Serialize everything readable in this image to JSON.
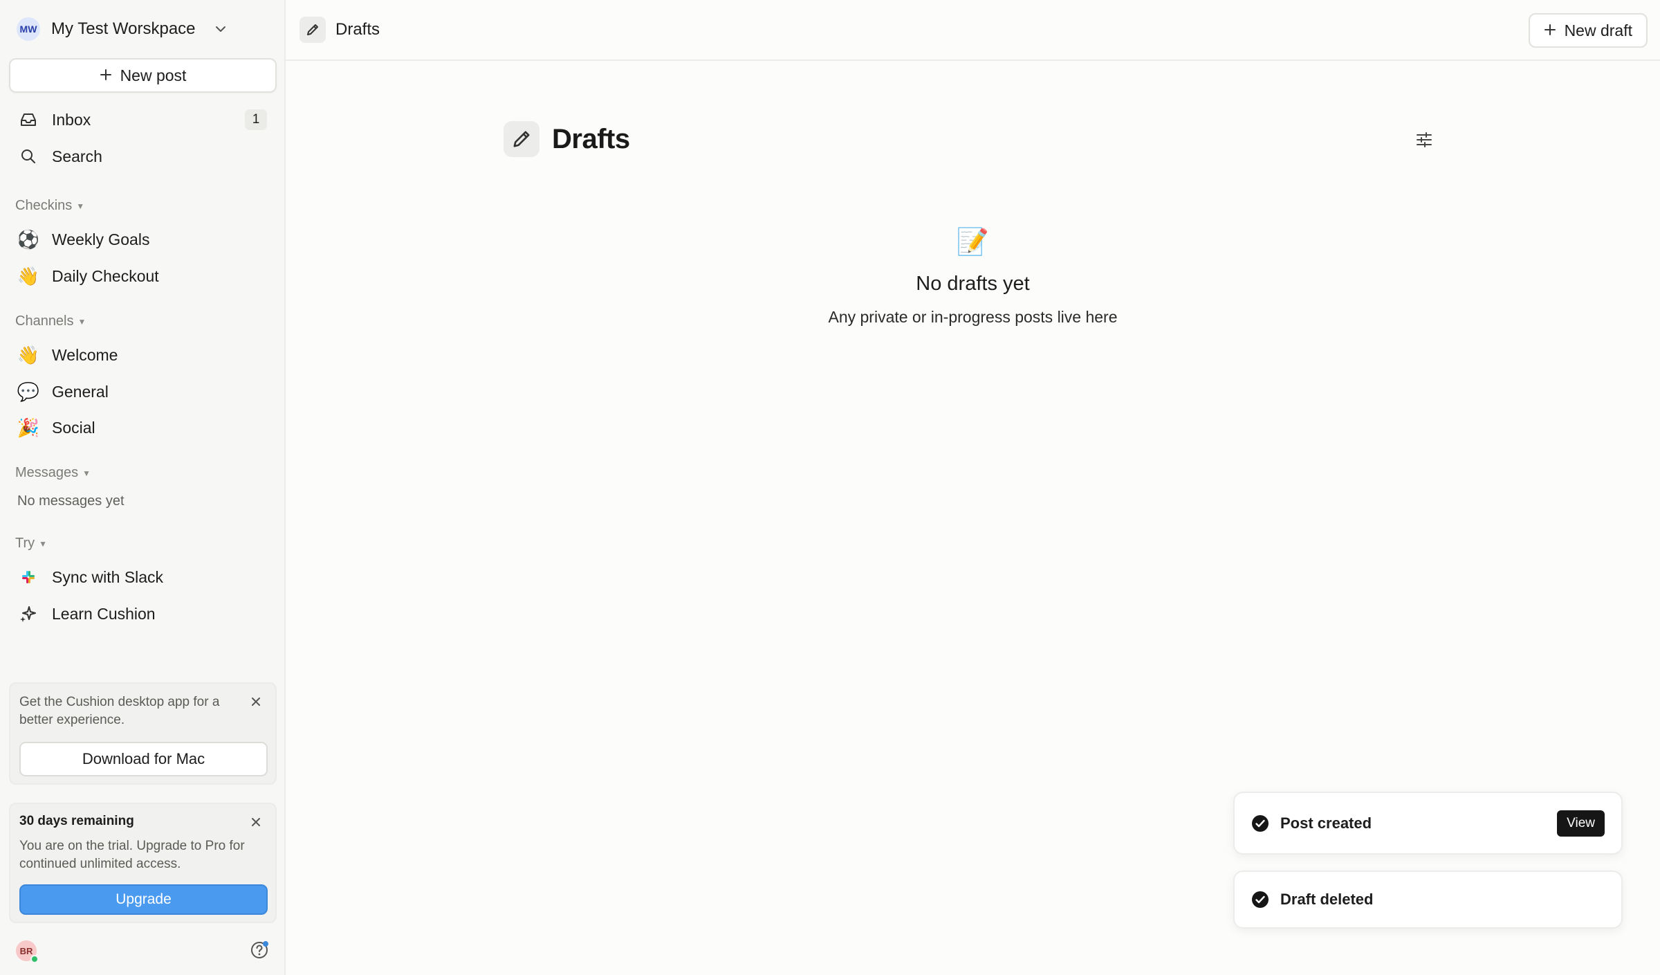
{
  "workspace": {
    "initials": "MW",
    "name": "My Test Worskpace"
  },
  "sidebar": {
    "new_post_label": "New post",
    "inbox": {
      "label": "Inbox",
      "count": "1"
    },
    "search_label": "Search",
    "checkins": {
      "title": "Checkins",
      "items": [
        {
          "icon": "⚽",
          "label": "Weekly Goals"
        },
        {
          "icon": "👋",
          "label": "Daily Checkout"
        }
      ]
    },
    "channels": {
      "title": "Channels",
      "items": [
        {
          "icon": "👋",
          "label": "Welcome"
        },
        {
          "icon": "💬",
          "label": "General"
        },
        {
          "icon": "🎉",
          "label": "Social"
        }
      ]
    },
    "messages": {
      "title": "Messages",
      "empty": "No messages yet"
    },
    "try": {
      "title": "Try",
      "items": [
        {
          "icon": "slack-icon",
          "label": "Sync with Slack"
        },
        {
          "icon": "sparkle-icon",
          "label": "Learn Cushion"
        }
      ]
    },
    "desktop_promo": {
      "text": "Get the Cushion desktop app for a better experience.",
      "button": "Download for Mac"
    },
    "trial": {
      "title": "30 days remaining",
      "text": "You are on the trial. Upgrade to Pro for continued unlimited access.",
      "button": "Upgrade"
    },
    "user_initials": "BR"
  },
  "topbar": {
    "title": "Drafts",
    "new_draft_label": "New draft"
  },
  "main": {
    "title": "Drafts",
    "empty_emoji": "📝",
    "empty_title": "No drafts yet",
    "empty_subtitle": "Any private or in-progress posts live here"
  },
  "toasts": [
    {
      "text": "Post created",
      "action": "View"
    },
    {
      "text": "Draft deleted"
    }
  ],
  "colors": {
    "accent": "#4a9bef",
    "online": "#2fbf6b"
  }
}
